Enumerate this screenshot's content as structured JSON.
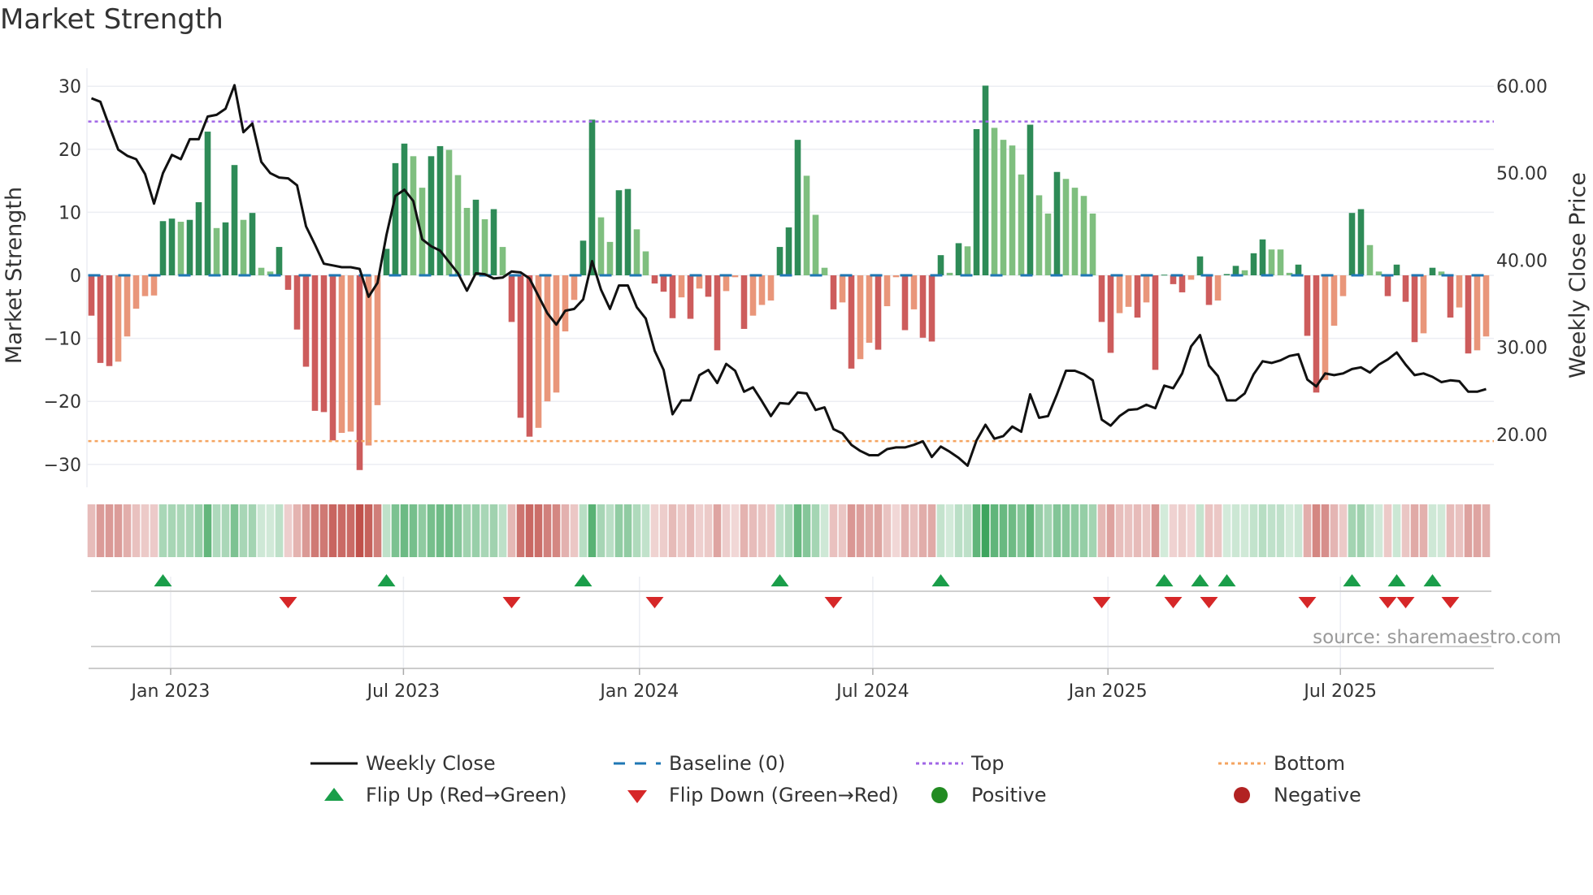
{
  "title": "Market Strength",
  "source": "source: sharemaestro.com",
  "colors": {
    "pos_strong": "#2e8b57",
    "pos_weak": "#7fbf7f",
    "neg_strong": "#cd5c5c",
    "neg_weak": "#e9967a",
    "heat_pos": "#3aa35a",
    "heat_neg": "#c0504a",
    "close": "#111111",
    "baseline": "#1f77b4",
    "top": "#a066e6",
    "bottom": "#f4a460",
    "flip_up": "#1a9e4a",
    "flip_down": "#d62728",
    "positive": "#228b22",
    "negative": "#b22222"
  },
  "legend": {
    "weekly_close": "Weekly Close",
    "baseline": "Baseline (0)",
    "top": "Top",
    "bottom": "Bottom",
    "flip_up": "Flip Up (Red→Green)",
    "flip_down": "Flip Down (Green→Red)",
    "positive": "Positive",
    "negative": "Negative"
  },
  "chart_data": {
    "type": "bar",
    "title": "Market Strength",
    "ylabel": "Market Strength",
    "ylabel_right": "Weekly Close Price",
    "ylim": [
      -33,
      32
    ],
    "ylim_right": [
      15.1,
      64.8
    ],
    "yticks": [
      -30,
      -20,
      -10,
      0,
      10,
      20,
      30
    ],
    "yticklabels": [
      "−30",
      "−20",
      "−10",
      "0",
      "10",
      "20",
      "30"
    ],
    "yticks_right": [
      20,
      30,
      40,
      50,
      60
    ],
    "yticklabels_right": [
      "20.00",
      "30.00",
      "40.00",
      "50.00",
      "60.00"
    ],
    "xticks": [
      {
        "label": "Jan 2023",
        "week": 8.86
      },
      {
        "label": "Jul 2023",
        "week": 34.9
      },
      {
        "label": "Jan 2024",
        "week": 61.3
      },
      {
        "label": "Jul 2024",
        "week": 87.4
      },
      {
        "label": "Jan 2025",
        "week": 113.7
      },
      {
        "label": "Jul 2025",
        "week": 139.7
      }
    ],
    "top_level": 24.4,
    "bottom_level": -26.3,
    "baseline": 0,
    "grid": true,
    "legend_position": "bottom",
    "strength": [
      -6.4,
      -13.9,
      -14.4,
      -13.7,
      -9.7,
      -5.3,
      -3.3,
      -3.2,
      8.6,
      9.0,
      8.5,
      8.8,
      11.6,
      22.8,
      7.5,
      8.4,
      17.5,
      8.8,
      9.9,
      1.2,
      0.6,
      4.5,
      -2.3,
      -8.6,
      -14.5,
      -21.5,
      -21.7,
      -26.2,
      -25.0,
      -24.8,
      -30.9,
      -27.0,
      -20.6,
      4.2,
      17.8,
      20.9,
      18.9,
      13.9,
      18.9,
      20.5,
      19.9,
      15.9,
      10.7,
      12.0,
      8.9,
      10.5,
      4.5,
      -7.4,
      -22.6,
      -25.6,
      -24.2,
      -20.0,
      -18.6,
      -8.9,
      -3.9,
      5.5,
      24.7,
      9.2,
      5.3,
      13.5,
      13.7,
      7.3,
      3.8,
      -1.3,
      -2.6,
      -6.8,
      -3.5,
      -6.9,
      -2.1,
      -3.4,
      -11.9,
      -2.5,
      -0.3,
      -8.5,
      -6.4,
      -4.7,
      -4.0,
      4.5,
      7.6,
      21.5,
      15.8,
      9.6,
      1.2,
      -5.4,
      -4.3,
      -14.8,
      -13.3,
      -10.7,
      -11.8,
      -4.9,
      -0.3,
      -8.7,
      -5.4,
      -9.9,
      -10.5,
      3.2,
      0.4,
      5.1,
      4.6,
      23.2,
      30.1,
      23.4,
      21.5,
      20.6,
      16.0,
      23.9,
      12.7,
      9.8,
      16.4,
      15.3,
      13.9,
      12.6,
      9.8,
      -7.4,
      -12.3,
      -6.0,
      -5.0,
      -6.7,
      -4.3,
      -15.0,
      0.1,
      -1.4,
      -2.7,
      -0.7,
      3.0,
      -4.7,
      -4.0,
      0.2,
      1.5,
      0.8,
      3.5,
      5.7,
      4.1,
      4.1,
      0.4,
      1.7,
      -9.6,
      -18.6,
      -16.6,
      -8.0,
      -3.3,
      9.9,
      10.5,
      4.8,
      0.6,
      -3.3,
      1.7,
      -4.2,
      -10.6,
      -9.2,
      1.2,
      0.6,
      -6.7,
      -5.1,
      -12.4,
      -11.9,
      -9.7
    ],
    "weekly_close": [
      58.6,
      58.2,
      55.4,
      52.7,
      52.0,
      51.6,
      49.9,
      46.5,
      50.0,
      52.1,
      51.6,
      53.9,
      53.9,
      56.5,
      56.7,
      57.4,
      60.1,
      54.7,
      55.7,
      51.3,
      50.0,
      49.5,
      49.4,
      48.6,
      43.9,
      41.8,
      39.6,
      39.4,
      39.2,
      39.2,
      39.0,
      35.8,
      37.4,
      42.9,
      47.4,
      48.1,
      46.8,
      42.4,
      41.6,
      41.1,
      39.8,
      38.5,
      36.5,
      38.5,
      38.4,
      37.9,
      38.0,
      38.7,
      38.6,
      37.9,
      35.9,
      33.9,
      32.6,
      34.2,
      34.4,
      35.5,
      39.9,
      36.6,
      34.4,
      37.1,
      37.1,
      34.6,
      33.3,
      29.6,
      27.4,
      22.3,
      23.9,
      23.9,
      26.8,
      27.4,
      25.9,
      28.1,
      27.3,
      24.9,
      25.4,
      23.8,
      22.1,
      23.6,
      23.5,
      24.8,
      24.7,
      22.8,
      23.1,
      20.6,
      20.1,
      18.8,
      18.1,
      17.6,
      17.6,
      18.3,
      18.5,
      18.5,
      18.8,
      19.2,
      17.4,
      18.6,
      18.0,
      17.3,
      16.4,
      19.3,
      21.1,
      19.5,
      19.8,
      20.9,
      20.3,
      24.6,
      21.9,
      22.1,
      24.6,
      27.3,
      27.3,
      26.9,
      26.2,
      21.7,
      21.0,
      22.1,
      22.8,
      22.9,
      23.4,
      23.0,
      25.6,
      25.3,
      27.0,
      30.1,
      31.4,
      27.9,
      26.7,
      23.9,
      23.9,
      24.7,
      26.9,
      28.4,
      28.2,
      28.5,
      29.0,
      29.2,
      26.3,
      25.5,
      27.0,
      26.8,
      27.0,
      27.5,
      27.7,
      27.1,
      28.0,
      28.6,
      29.4,
      28.0,
      26.8,
      27.0,
      26.6,
      26.0,
      26.2,
      26.1,
      24.9,
      24.9,
      25.2
    ]
  }
}
